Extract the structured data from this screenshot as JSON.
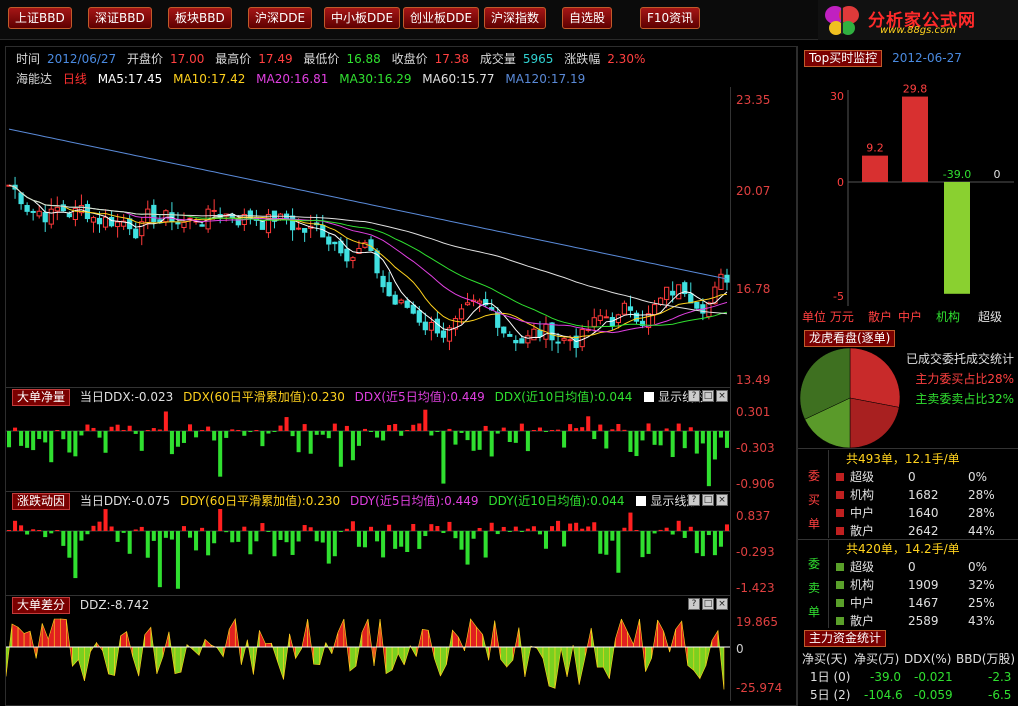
{
  "toolbar": {
    "buttons": [
      "上证BBD",
      "深证BBD",
      "板块BBD",
      "沪深DDE",
      "中小板DDE",
      "创业板DDE",
      "沪深指数",
      "自选股",
      "F10资讯"
    ]
  },
  "logo": {
    "brand": "分析家公式网",
    "url": "www.88gs.com"
  },
  "quote": {
    "time_label": "时间",
    "date": "2012/06/27",
    "open_label": "开盘价",
    "open": "17.00",
    "high_label": "最高价",
    "high": "17.49",
    "low_label": "最低价",
    "low": "16.88",
    "close_label": "收盘价",
    "close": "17.38",
    "volume_label": "成交量",
    "volume": "5965",
    "change_label": "涨跌幅",
    "change": "2.30%"
  },
  "kline": {
    "stock": "海能达",
    "period": "日线",
    "ma": [
      "MA5:17.45",
      "MA10:17.42",
      "MA20:16.81",
      "MA30:16.29",
      "MA60:15.77",
      "MA120:17.19"
    ],
    "ma_colors": [
      "#ffffff",
      "#ffd21e",
      "#e040e0",
      "#30e030",
      "#e0e0e0",
      "#5a8ad8"
    ],
    "axis": [
      "23.35",
      "20.07",
      "16.78",
      "13.49"
    ]
  },
  "ddx": {
    "tag": "大单净量",
    "current": "当日DDX:-0.023",
    "sum": "DDX(60日平滑累加值):0.230",
    "avg5": "DDX(近5日均值):0.449",
    "avg10": "DDX(近10日均值):0.044",
    "show_line": "显示线形",
    "axis": [
      "0.301",
      "-0.303",
      "-0.906"
    ]
  },
  "ddy": {
    "tag": "涨跌动因",
    "current": "当日DDY:-0.075",
    "sum": "DDY(60日平滑累加值):0.230",
    "avg5": "DDY(近5日均值):0.449",
    "avg10": "DDY(近10日均值):0.044",
    "show_line": "显示线形",
    "axis": [
      "0.837",
      "-0.293",
      "-1.423"
    ]
  },
  "ddz": {
    "tag": "大单差分",
    "current": "DDZ:-8.742",
    "axis": [
      "19.865",
      "0",
      "-25.974"
    ]
  },
  "ctrl_labels": [
    "?",
    "□",
    "×"
  ],
  "right": {
    "top_tag": "Top买时监控",
    "top_date": "2012-06-27",
    "bar_axis": [
      "30",
      "0",
      "-5"
    ],
    "unit_label": "单位 万元",
    "categories": [
      "散户",
      "中户",
      "机构",
      "超级"
    ],
    "bar_labels": [
      "9.2",
      "29.8",
      "-39.0",
      "0"
    ],
    "dragon_tag": "龙虎看盘(逐单)",
    "pie_title": "已成交委托成交统计",
    "buy_share": "主力委买占比28%",
    "sell_share": "主卖委卖占比32%",
    "buy_group": {
      "label": [
        "委",
        "买",
        "单"
      ],
      "header": "共493单，12.1手/单",
      "rows": [
        {
          "name": "超级",
          "count": "0",
          "pct": "0%"
        },
        {
          "name": "机构",
          "count": "1682",
          "pct": "28%"
        },
        {
          "name": "中户",
          "count": "1640",
          "pct": "28%"
        },
        {
          "name": "散户",
          "count": "2642",
          "pct": "44%"
        }
      ]
    },
    "sell_group": {
      "label": [
        "委",
        "卖",
        "单"
      ],
      "header": "共420单，14.2手/单",
      "rows": [
        {
          "name": "超级",
          "count": "0",
          "pct": "0%"
        },
        {
          "name": "机构",
          "count": "1909",
          "pct": "32%"
        },
        {
          "name": "中户",
          "count": "1467",
          "pct": "25%"
        },
        {
          "name": "散户",
          "count": "2589",
          "pct": "43%"
        }
      ]
    },
    "fund_tag": "主力资金统计",
    "fund_headers": [
      "净买(天)",
      "净买(万)",
      "DDX(%)",
      "BBD(万股)"
    ],
    "fund_rows": [
      {
        "days": "1日 (0)",
        "net": "-39.0",
        "ddx": "-0.021",
        "bbd": "-2.3"
      },
      {
        "days": "5日 (2)",
        "net": "-104.6",
        "ddx": "-0.059",
        "bbd": "-6.5"
      }
    ]
  },
  "chart_data": {
    "type": "bar",
    "title": "Top买时监控",
    "categories": [
      "散户",
      "中户",
      "机构",
      "超级"
    ],
    "values": [
      9.2,
      29.8,
      -39.0,
      0
    ],
    "ylim": [
      -5,
      30
    ],
    "colors": [
      "#d83030",
      "#d83030",
      "#8ad030",
      "#8ad030"
    ]
  }
}
